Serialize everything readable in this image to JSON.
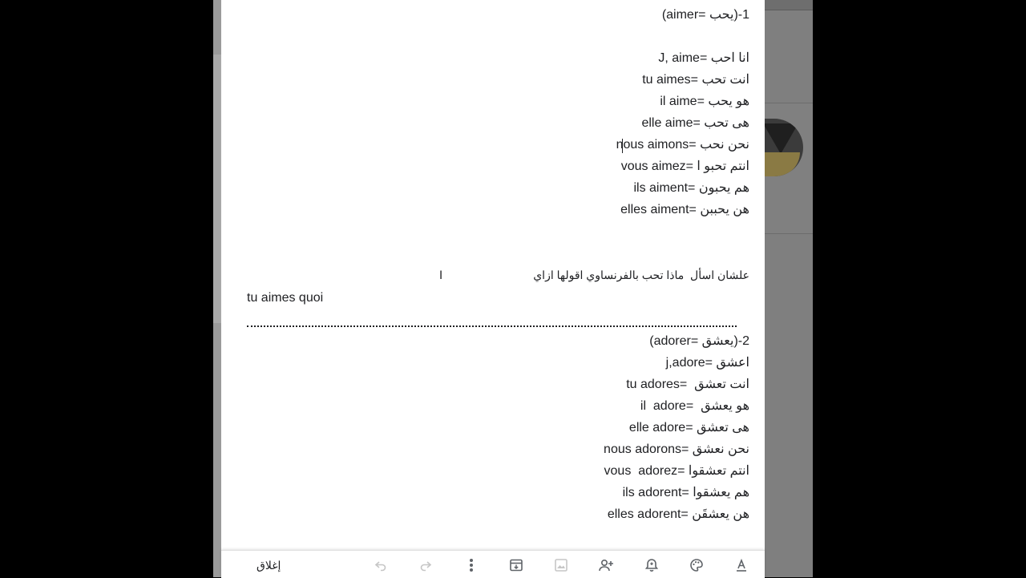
{
  "note": {
    "lines": [
      "(aimer= يحب)-1",
      "J, aime= انا احب",
      "tu aimes= انت تحب",
      "il aime= هو يحب",
      "elle aime= هى تحب",
      "nous aimons= نحن نحب",
      "vous aimez= انتم تحبو ا",
      "ils aiment= هم يحبون",
      "elles aiment= هن يحببن",
      "علشان اسأل  ماذا تحب بالفرنساوي اقولها ازاي",
      "tu aimes quoi",
      "(adorer= يعشق)-2",
      "j,adore= اعشق",
      "tu adores=  انت تعشق",
      "il  adore=  هو يعشق",
      "elle adore= هى تعشق",
      "nous adorons= نحن نعشق",
      "vous  adorez= انتم تعشقوا",
      "ils adorent= هم يعشقوا",
      "elles adorent= هن يعشقَن"
    ]
  },
  "toolbar": {
    "close_label": "إغلاق",
    "icons": [
      "undo-icon",
      "redo-icon",
      "more-icon",
      "archive-icon",
      "add-image-icon",
      "add-collaborator-icon",
      "reminder-icon",
      "palette-icon",
      "text-format-icon"
    ]
  }
}
